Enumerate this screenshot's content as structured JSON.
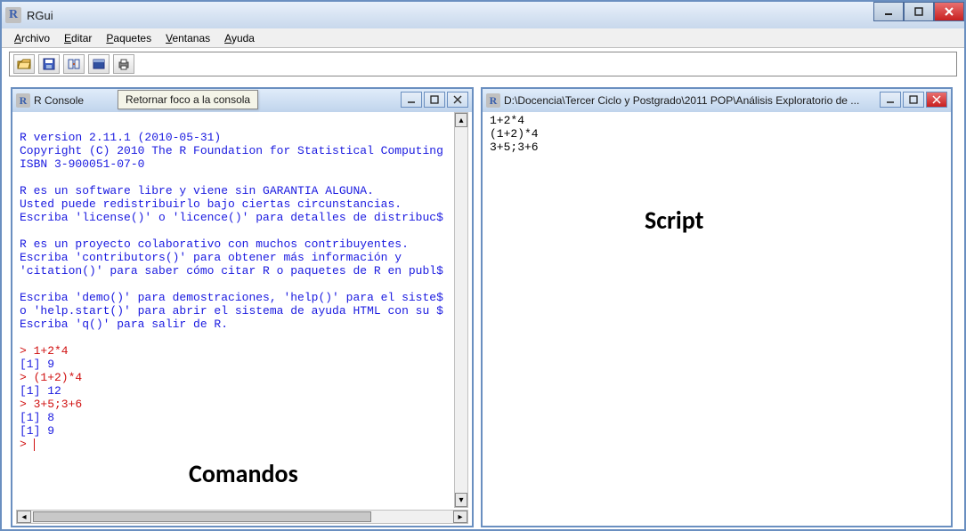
{
  "window": {
    "title": "RGui"
  },
  "menu": {
    "archivo": "Archivo",
    "editar": "Editar",
    "paquetes": "Paquetes",
    "ventanas": "Ventanas",
    "ayuda": "Ayuda"
  },
  "tooltip": {
    "text": "Retornar foco a la consola"
  },
  "console": {
    "title": "R Console",
    "lines": [
      {
        "t": "out",
        "v": ""
      },
      {
        "t": "out",
        "v": "R version 2.11.1 (2010-05-31)"
      },
      {
        "t": "out",
        "v": "Copyright (C) 2010 The R Foundation for Statistical Computing"
      },
      {
        "t": "out",
        "v": "ISBN 3-900051-07-0"
      },
      {
        "t": "out",
        "v": ""
      },
      {
        "t": "out",
        "v": "R es un software libre y viene sin GARANTIA ALGUNA."
      },
      {
        "t": "out",
        "v": "Usted puede redistribuirlo bajo ciertas circunstancias."
      },
      {
        "t": "out",
        "v": "Escriba 'license()' o 'licence()' para detalles de distribuc$"
      },
      {
        "t": "out",
        "v": ""
      },
      {
        "t": "out",
        "v": "R es un proyecto colaborativo con muchos contribuyentes."
      },
      {
        "t": "out",
        "v": "Escriba 'contributors()' para obtener más información y"
      },
      {
        "t": "out",
        "v": "'citation()' para saber cómo citar R o paquetes de R en publ$"
      },
      {
        "t": "out",
        "v": ""
      },
      {
        "t": "out",
        "v": "Escriba 'demo()' para demostraciones, 'help()' para el siste$"
      },
      {
        "t": "out",
        "v": "o 'help.start()' para abrir el sistema de ayuda HTML con su $"
      },
      {
        "t": "out",
        "v": "Escriba 'q()' para salir de R."
      },
      {
        "t": "out",
        "v": ""
      },
      {
        "t": "cmd",
        "v": "> 1+2*4"
      },
      {
        "t": "out",
        "v": "[1] 9"
      },
      {
        "t": "cmd",
        "v": "> (1+2)*4"
      },
      {
        "t": "out",
        "v": "[1] 12"
      },
      {
        "t": "cmd",
        "v": "> 3+5;3+6"
      },
      {
        "t": "out",
        "v": "[1] 8"
      },
      {
        "t": "out",
        "v": "[1] 9"
      },
      {
        "t": "cmd",
        "v": "> "
      }
    ]
  },
  "script": {
    "title": "D:\\Docencia\\Tercer Ciclo y Postgrado\\2011 POP\\Análisis Exploratorio de ...",
    "lines": [
      "1+2*4",
      "(1+2)*4",
      "3+5;3+6"
    ]
  },
  "overlays": {
    "comandos": "Comandos",
    "script": "Script"
  },
  "icons": {
    "open": "open-icon",
    "save": "save-icon",
    "refresh": "refresh-icon",
    "window": "window-icon",
    "print": "print-icon"
  }
}
